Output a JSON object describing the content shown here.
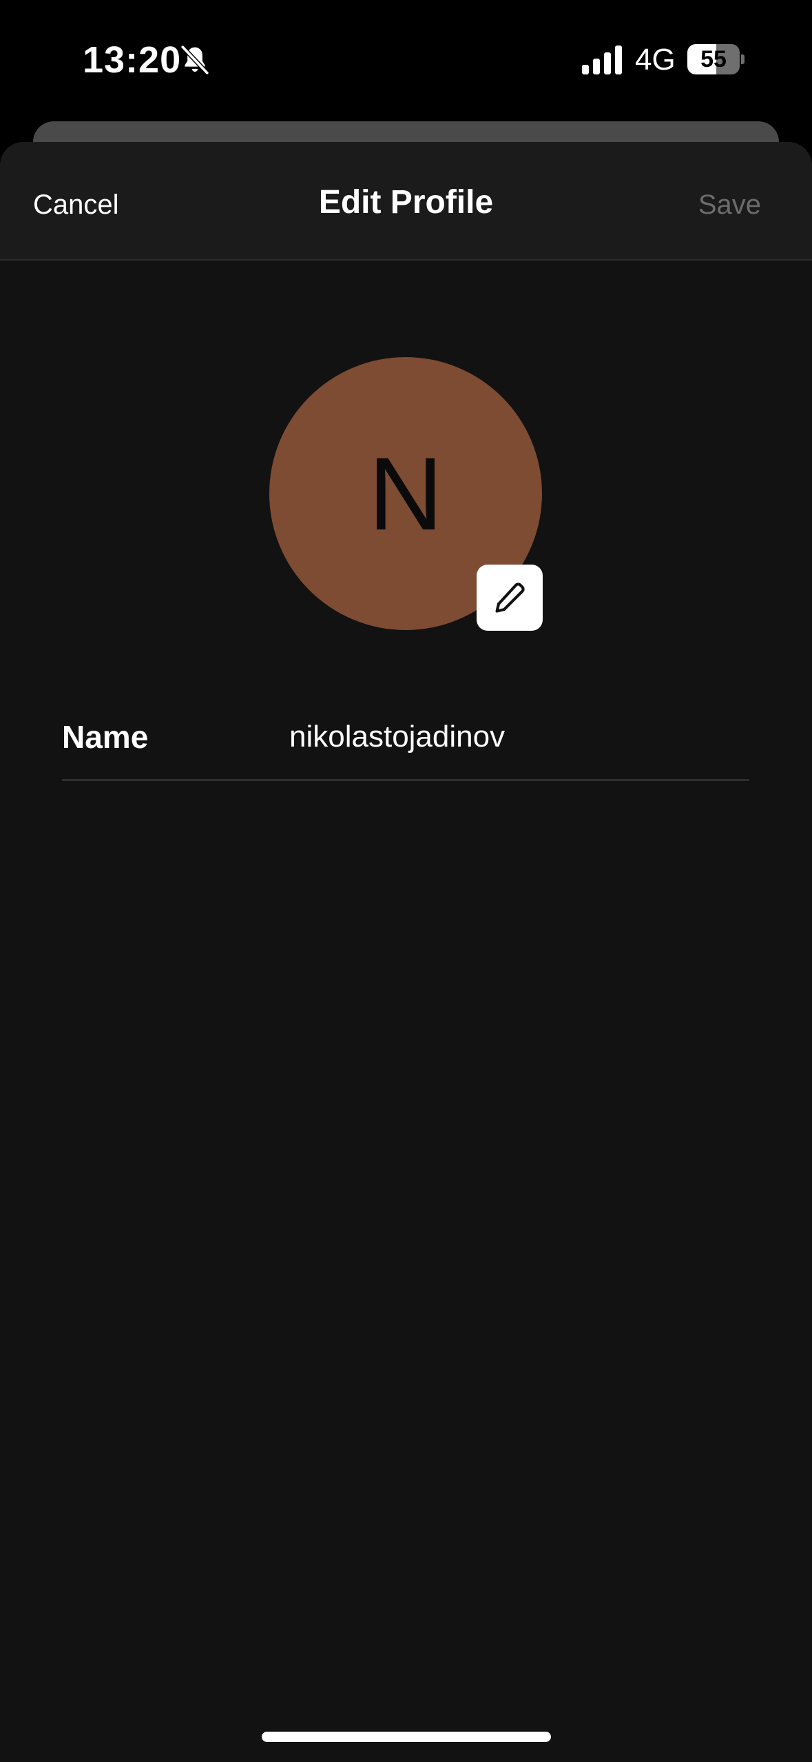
{
  "status_bar": {
    "time": "13:20",
    "bell_icon": "bell-slash-icon",
    "signal_icon": "cellular-signal-icon",
    "network": "4G",
    "battery_level": "55",
    "battery_fraction": 0.55
  },
  "header": {
    "cancel_label": "Cancel",
    "title": "Edit Profile",
    "save_label": "Save"
  },
  "avatar": {
    "initial": "N",
    "color": "#7e4b33",
    "edit_icon": "pencil-icon"
  },
  "form": {
    "name_label": "Name",
    "name_value": "nikolastojadinov"
  },
  "colors": {
    "background": "#121212",
    "header_background": "#1b1b1b",
    "save_disabled": "#6c6c6c"
  }
}
